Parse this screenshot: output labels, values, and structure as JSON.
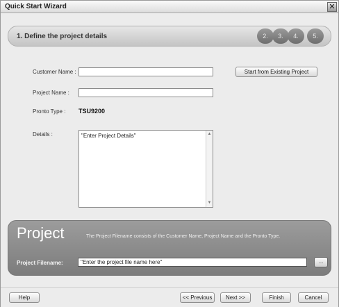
{
  "window": {
    "title": "Quick Start Wizard",
    "close_glyph": "✕"
  },
  "steps": {
    "current_title": "1. Define the project details",
    "pills": [
      "2.",
      "3.",
      "4.",
      "5."
    ]
  },
  "form": {
    "customer_name_label": "Customer Name :",
    "customer_name_value": "",
    "project_name_label": "Project Name :",
    "project_name_value": "",
    "pronto_type_label": "Pronto Type :",
    "pronto_type_value": "TSU9200",
    "details_label": "Details :",
    "details_value": "\"Enter Project Details\"",
    "start_existing_button": "Start from Existing Project"
  },
  "project": {
    "heading": "Project",
    "description": "The Project Filename consists of the Customer Name, Project Name and the Pronto Type.",
    "filename_label": "Project Filename:",
    "filename_value": "\"Enter the project file name here\"",
    "browse_label": "..."
  },
  "footer": {
    "help": "Help",
    "previous": "<< Previous",
    "next": "Next >>",
    "finish": "Finish",
    "cancel": "Cancel"
  }
}
